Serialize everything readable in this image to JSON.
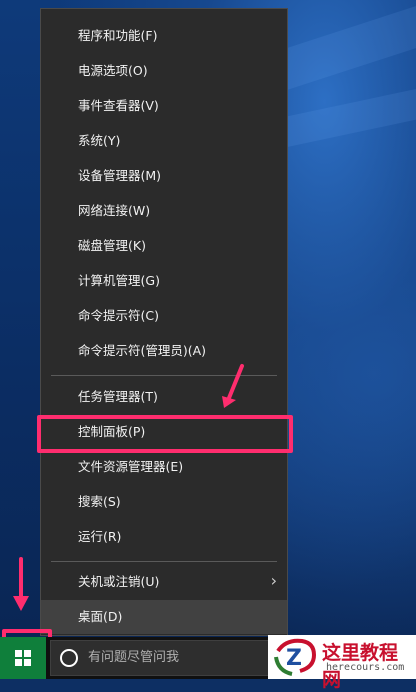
{
  "menu": {
    "items": [
      {
        "label": "程序和功能(F)"
      },
      {
        "label": "电源选项(O)"
      },
      {
        "label": "事件查看器(V)"
      },
      {
        "label": "系统(Y)"
      },
      {
        "label": "设备管理器(M)"
      },
      {
        "label": "网络连接(W)"
      },
      {
        "label": "磁盘管理(K)"
      },
      {
        "label": "计算机管理(G)"
      },
      {
        "label": "命令提示符(C)"
      },
      {
        "label": "命令提示符(管理员)(A)"
      },
      {
        "label": "任务管理器(T)"
      },
      {
        "label": "控制面板(P)"
      },
      {
        "label": "文件资源管理器(E)"
      },
      {
        "label": "搜索(S)"
      },
      {
        "label": "运行(R)"
      },
      {
        "label": "关机或注销(U)"
      },
      {
        "label": "桌面(D)"
      }
    ]
  },
  "taskbar": {
    "search_placeholder": "有问题尽管问我"
  },
  "watermark": {
    "title": "这里教程网",
    "url": "herecours.com"
  },
  "colors": {
    "highlight": "#ff2d6e",
    "menu_bg": "#2b2b2b",
    "start_button": "#0f7f3b"
  }
}
